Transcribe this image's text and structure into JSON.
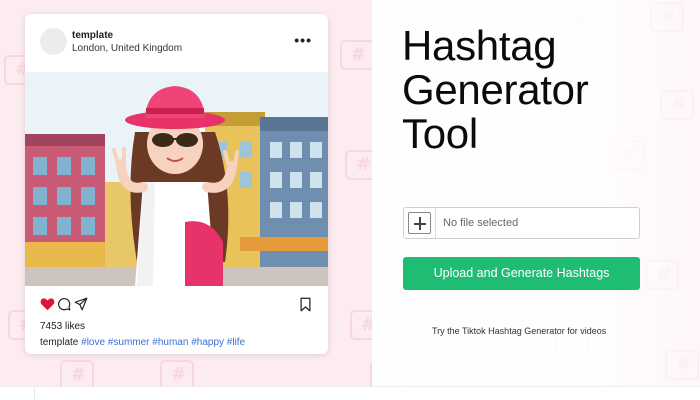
{
  "post": {
    "username": "template",
    "location": "London, United Kingdom",
    "more_icon": "more-dots-icon",
    "likes": "7453 likes",
    "caption_user": "template",
    "caption_tags": "#love #summer #human #happy #life",
    "icons": [
      "heart-icon",
      "comment-icon",
      "share-icon",
      "bookmark-icon"
    ]
  },
  "tool": {
    "title_line1": "Hashtag",
    "title_line2": "Generator",
    "title_line3": "Tool",
    "file_placeholder": "No file selected",
    "upload_label": "Upload and Generate Hashtags",
    "tiktok_link": "Try the Tiktok Hashtag Generator for videos"
  },
  "colors": {
    "background": "#fcebef",
    "button": "#1ebd73",
    "heart": "#e0153b",
    "hashtag": "#3b6fd1"
  }
}
